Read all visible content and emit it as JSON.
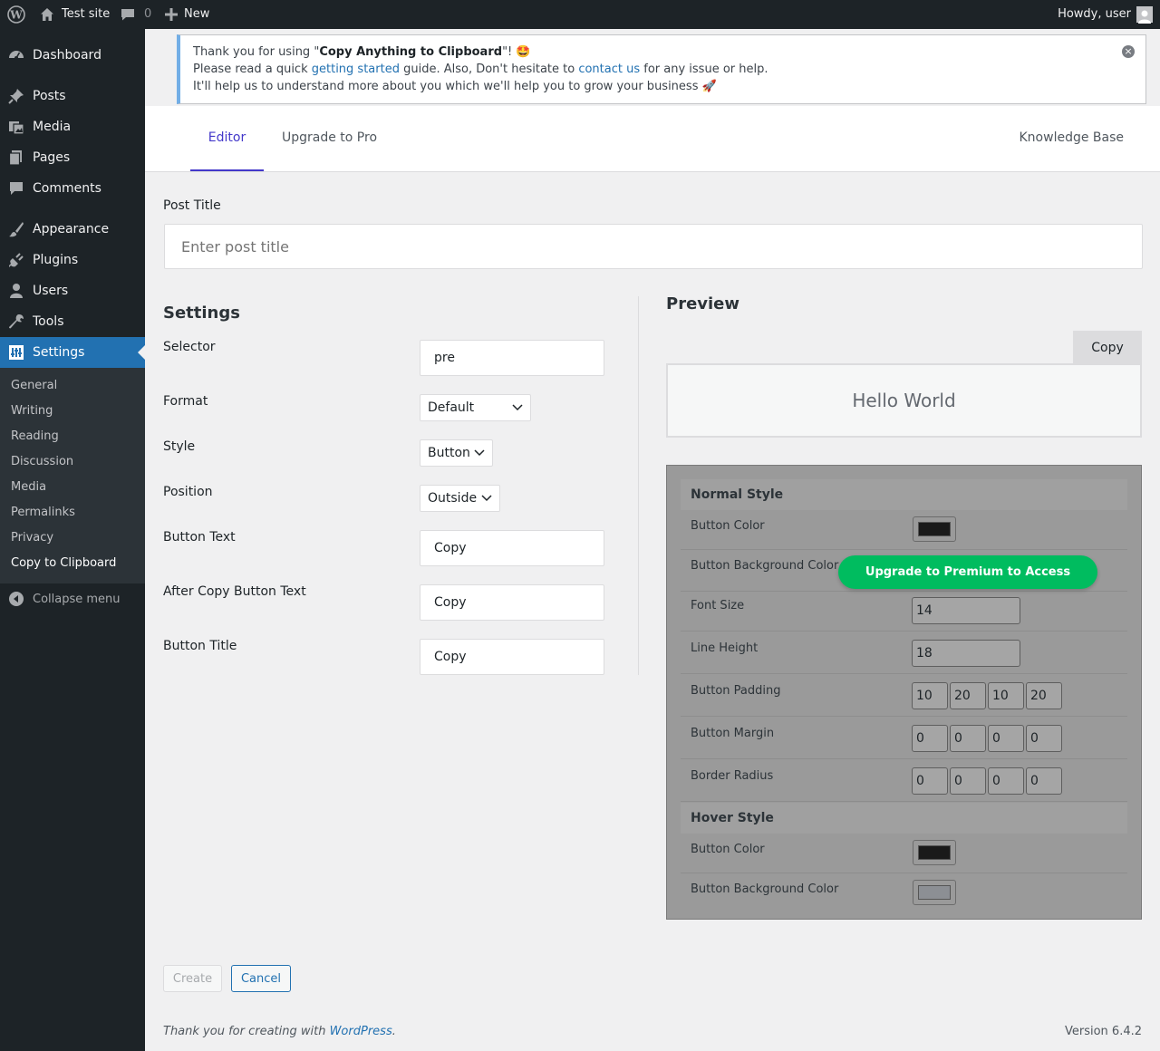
{
  "adminbar": {
    "site_name": "Test site",
    "comments_count": "0",
    "new_label": "New",
    "howdy": "Howdy, user"
  },
  "sidebar": {
    "items": [
      {
        "label": "Dashboard",
        "icon": "dashboard-icon"
      },
      {
        "label": "Posts",
        "icon": "pin-icon"
      },
      {
        "label": "Media",
        "icon": "media-icon"
      },
      {
        "label": "Pages",
        "icon": "pages-icon"
      },
      {
        "label": "Comments",
        "icon": "comment-icon"
      },
      {
        "label": "Appearance",
        "icon": "brush-icon"
      },
      {
        "label": "Plugins",
        "icon": "plug-icon"
      },
      {
        "label": "Users",
        "icon": "user-icon"
      },
      {
        "label": "Tools",
        "icon": "wrench-icon"
      },
      {
        "label": "Settings",
        "icon": "settings-icon"
      }
    ],
    "submenu": [
      "General",
      "Writing",
      "Reading",
      "Discussion",
      "Media",
      "Permalinks",
      "Privacy",
      "Copy to Clipboard"
    ],
    "collapse_label": "Collapse menu"
  },
  "notice": {
    "line1_prefix": "Thank you for using \"",
    "plugin_name": "Copy Anything to Clipboard",
    "line1_suffix": "\"! 🤩",
    "line2_prefix": "Please read a quick ",
    "getting_started": "getting started",
    "line2_mid": " guide. Also, Don't hesitate to ",
    "contact_us": "contact us",
    "line2_suffix": " for any issue or help.",
    "line3": "It'll help us to understand more about you which we'll help you to grow your business 🚀"
  },
  "tabs": {
    "editor": "Editor",
    "upgrade": "Upgrade to Pro",
    "knowledge_base": "Knowledge Base"
  },
  "post_title": {
    "label": "Post Title",
    "placeholder": "Enter post title"
  },
  "settings": {
    "heading": "Settings",
    "selector_label": "Selector",
    "selector_value": "pre",
    "format_label": "Format",
    "format_value": "Default",
    "style_label": "Style",
    "style_value": "Button",
    "position_label": "Position",
    "position_value": "Outside",
    "button_text_label": "Button Text",
    "button_text_value": "Copy",
    "after_copy_label": "After Copy Button Text",
    "after_copy_value": "Copy",
    "button_title_label": "Button Title",
    "button_title_value": "Copy"
  },
  "preview": {
    "heading": "Preview",
    "copy_button": "Copy",
    "sample_text": "Hello World"
  },
  "style_panel": {
    "normal_heading": "Normal Style",
    "button_color": "Button Color",
    "button_bg_color": "Button Background Color",
    "font_size_label": "Font Size",
    "font_size": "14",
    "line_height_label": "Line Height",
    "line_height": "18",
    "padding_label": "Button Padding",
    "padding": [
      "10",
      "20",
      "10",
      "20"
    ],
    "margin_label": "Button Margin",
    "margin": [
      "0",
      "0",
      "0",
      "0"
    ],
    "radius_label": "Border Radius",
    "radius": [
      "0",
      "0",
      "0",
      "0"
    ],
    "hover_heading": "Hover Style",
    "hover_button_color": "Button Color",
    "hover_button_bg_color": "Button Background Color",
    "upgrade_overlay": "Upgrade to Premium to Access",
    "colors": {
      "normal_button": "#1a1a1a",
      "hover_button": "#1a1a1a",
      "hover_bg": "#8c8f94"
    }
  },
  "actions": {
    "create": "Create",
    "cancel": "Cancel"
  },
  "footer": {
    "thanks_prefix": "Thank you for creating with ",
    "wordpress": "WordPress",
    "thanks_suffix": ".",
    "version": "Version 6.4.2"
  }
}
